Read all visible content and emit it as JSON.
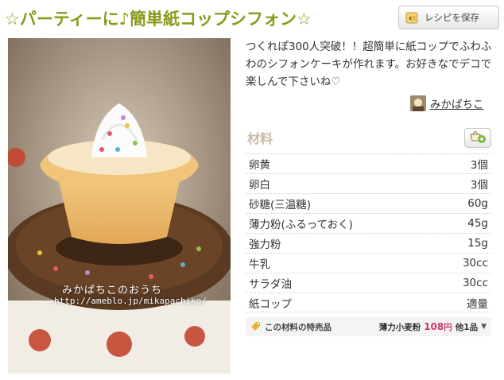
{
  "title": "☆パーティーに♪簡単紙コップシフォン☆",
  "save_button": {
    "label": "レシピを保存",
    "icon": "bookmark-hand-icon"
  },
  "photo": {
    "watermark_name": "みかぱちこのおうち",
    "watermark_url": "http://ameblo.jp/mikapachiko/"
  },
  "description": "つくれぽ300人突破！！超簡単に紙コップでふわふわのシフォンケーキが作れます。お好きなでデコで楽しんで下さいね♡",
  "author": {
    "name": "みかぱちこ"
  },
  "ingredients": {
    "heading": "材料",
    "add_icon": "add-to-list-icon",
    "items": [
      {
        "name": "卵黄",
        "qty": "3個"
      },
      {
        "name": "卵白",
        "qty": "3個"
      },
      {
        "name": "砂糖(三温糖)",
        "qty": "60g"
      },
      {
        "name": "薄力粉(ふるっておく)",
        "qty": "45g"
      },
      {
        "name": "強力粉",
        "qty": "15g"
      },
      {
        "name": "牛乳",
        "qty": "30cc"
      },
      {
        "name": "サラダ油",
        "qty": "30cc"
      },
      {
        "name": "紙コップ",
        "qty": "適量"
      }
    ]
  },
  "promo": {
    "label": "この材料の特売品",
    "item": "薄力小麦粉",
    "price": "108",
    "yen": "円",
    "others": "他1品"
  },
  "colors": {
    "title": "#8a9a1b",
    "price": "#d0336b",
    "heading": "#c9bba6"
  }
}
